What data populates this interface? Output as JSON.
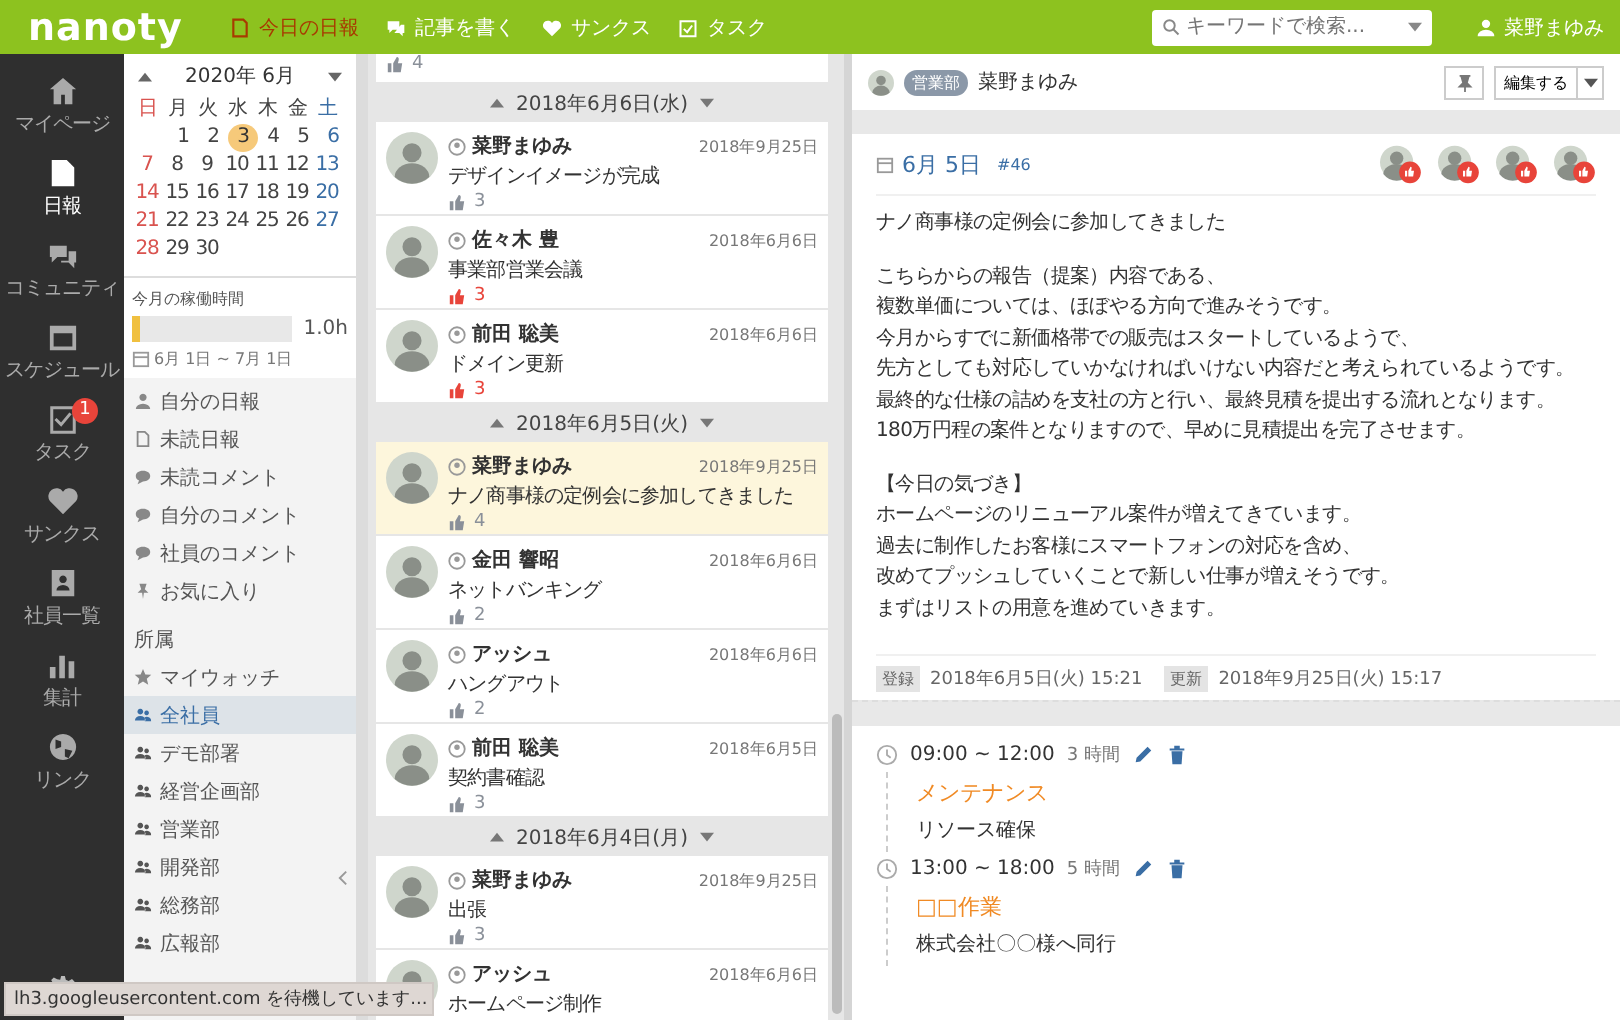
{
  "topbar": {
    "logo": "nanoty",
    "nav": [
      {
        "label": "今日の日報",
        "selected": true
      },
      {
        "label": "記事を書く",
        "selected": false
      },
      {
        "label": "サンクス",
        "selected": false
      },
      {
        "label": "タスク",
        "selected": false
      }
    ],
    "search": {
      "placeholder": "キーワードで検索..."
    },
    "user": "菜野まゆみ"
  },
  "sidebar": {
    "items": [
      {
        "label": "マイページ",
        "selected": false
      },
      {
        "label": "日報",
        "selected": true
      },
      {
        "label": "コミュニティ",
        "selected": false
      },
      {
        "label": "スケジュール",
        "selected": false
      },
      {
        "label": "タスク",
        "selected": false,
        "badge": "1"
      },
      {
        "label": "サンクス",
        "selected": false
      },
      {
        "label": "社員一覧",
        "selected": false
      },
      {
        "label": "集計",
        "selected": false
      },
      {
        "label": "リンク",
        "selected": false
      }
    ]
  },
  "calendar": {
    "title": "2020年 6月",
    "weekdays": [
      "日",
      "月",
      "火",
      "水",
      "木",
      "金",
      "土"
    ],
    "weeks": [
      [
        {
          "day": "1",
          "selected": false
        },
        {
          "day": "2",
          "selected": false
        },
        {
          "day": "3",
          "selected": true
        },
        {
          "day": "4",
          "selected": false
        },
        {
          "day": "5",
          "selected": false
        },
        {
          "day": "6",
          "selected": false
        }
      ],
      [
        {
          "day": "7",
          "selected": false
        },
        {
          "day": "8",
          "selected": false
        },
        {
          "day": "9",
          "selected": false
        },
        {
          "day": "10",
          "selected": false
        },
        {
          "day": "11",
          "selected": false
        },
        {
          "day": "12",
          "selected": false
        },
        {
          "day": "13",
          "selected": false
        }
      ],
      [
        {
          "day": "14",
          "selected": false
        },
        {
          "day": "15",
          "selected": false
        },
        {
          "day": "16",
          "selected": false
        },
        {
          "day": "17",
          "selected": false
        },
        {
          "day": "18",
          "selected": false
        },
        {
          "day": "19",
          "selected": false
        },
        {
          "day": "20",
          "selected": false
        }
      ],
      [
        {
          "day": "21",
          "selected": false
        },
        {
          "day": "22",
          "selected": false
        },
        {
          "day": "23",
          "selected": false
        },
        {
          "day": "24",
          "selected": false
        },
        {
          "day": "25",
          "selected": false
        },
        {
          "day": "26",
          "selected": false
        },
        {
          "day": "27",
          "selected": false
        }
      ],
      [
        {
          "day": "28",
          "selected": false
        },
        {
          "day": "29",
          "selected": false
        },
        {
          "day": "30",
          "selected": false
        }
      ]
    ]
  },
  "worktime": {
    "label": "今月の稼働時間",
    "level": 0.02,
    "reading": "1.0h",
    "range": "6月 1日 ~ 7月 1日"
  },
  "filters": [
    "自分の日報",
    "未読日報",
    "未読コメント",
    "自分のコメント",
    "社員のコメント",
    "お気に入り"
  ],
  "groups_title": "所属",
  "groups": [
    {
      "label": "マイウォッチ",
      "selected": false
    },
    {
      "label": "全社員",
      "selected": true
    },
    {
      "label": "デモ部署",
      "selected": false
    },
    {
      "label": "経営企画部",
      "selected": false
    },
    {
      "label": "営業部",
      "selected": false
    },
    {
      "label": "開発部",
      "selected": false
    },
    {
      "label": "総務部",
      "selected": false
    },
    {
      "label": "広報部",
      "selected": false
    }
  ],
  "reports": [
    {
      "entries": [
        {
          "likes": "4",
          "liked": false,
          "selected": false
        }
      ]
    },
    {
      "date": "2018年6月6日(水)",
      "entries": [
        {
          "name": "菜野まゆみ",
          "date": "2018年9月25日",
          "title": "デザインイメージが完成",
          "likes": "3",
          "liked": false,
          "selected": false
        },
        {
          "name": "佐々木 豊",
          "date": "2018年6月6日",
          "title": "事業部営業会議",
          "likes": "3",
          "liked": true,
          "selected": false
        },
        {
          "name": "前田 聡美",
          "date": "2018年6月6日",
          "title": "ドメイン更新",
          "likes": "3",
          "liked": true,
          "selected": false
        }
      ]
    },
    {
      "date": "2018年6月5日(火)",
      "entries": [
        {
          "name": "菜野まゆみ",
          "date": "2018年9月25日",
          "title": "ナノ商事様の定例会に参加してきました",
          "likes": "4",
          "liked": false,
          "selected": true
        },
        {
          "name": "金田 響昭",
          "date": "2018年6月6日",
          "title": "ネットバンキング",
          "likes": "2",
          "liked": false,
          "selected": false
        },
        {
          "name": "アッシュ",
          "date": "2018年6月6日",
          "title": "ハングアウト",
          "likes": "2",
          "liked": false,
          "selected": false
        },
        {
          "name": "前田 聡美",
          "date": "2018年6月5日",
          "title": "契約書確認",
          "likes": "3",
          "liked": false,
          "selected": false
        }
      ]
    },
    {
      "date": "2018年6月4日(月)",
      "entries": [
        {
          "name": "菜野まゆみ",
          "date": "2018年9月25日",
          "title": "出張",
          "likes": "3",
          "liked": false,
          "selected": false
        },
        {
          "name": "アッシュ",
          "date": "2018年6月6日",
          "title": "ホームページ制作",
          "selected": false
        }
      ]
    }
  ],
  "detail": {
    "department": "営業部",
    "author": "菜野まゆみ",
    "edit_button": "編集する",
    "date": "6月 5日",
    "number": "#46",
    "paragraphs": [
      [
        "ナノ商事様の定例会に参加してきました"
      ],
      [
        "こちらからの報告（提案）内容である、",
        "複数単価については、ほぼやる方向で進みそうです。",
        "今月からすでに新価格帯での販売はスタートしているようで、",
        "先方としても対応していかなければいけない内容だと考えられているようです。",
        "最終的な仕様の詰めを支社の方と行い、最終見積を提出する流れとなります。",
        "180万円程の案件となりますので、早めに見積提出を完了させます。"
      ],
      [
        "【今日の気づき】",
        "ホームページのリニューアル案件が増えてきています。",
        "過去に制作したお客様にスマートフォンの対応を含め、",
        "改めてプッシュしていくことで新しい仕事が増えそうです。",
        "まずはリストの用意を進めていきます。"
      ]
    ],
    "meta": [
      {
        "tag": "登録",
        "value": "2018年6月5日(火) 15:21"
      },
      {
        "tag": "更新",
        "value": "2018年9月25日(火) 15:17"
      }
    ],
    "schedule": [
      {
        "time": "09:00 ~ 12:00",
        "hours": "3 時間",
        "title": "メンテナンス",
        "note": "リソース確保"
      },
      {
        "time": "13:00 ~ 18:00",
        "hours": "5 時間",
        "title": "□□作業",
        "note": "株式会社〇〇様へ同行"
      }
    ]
  },
  "status_bar": "lh3.googleusercontent.com を待機しています..."
}
